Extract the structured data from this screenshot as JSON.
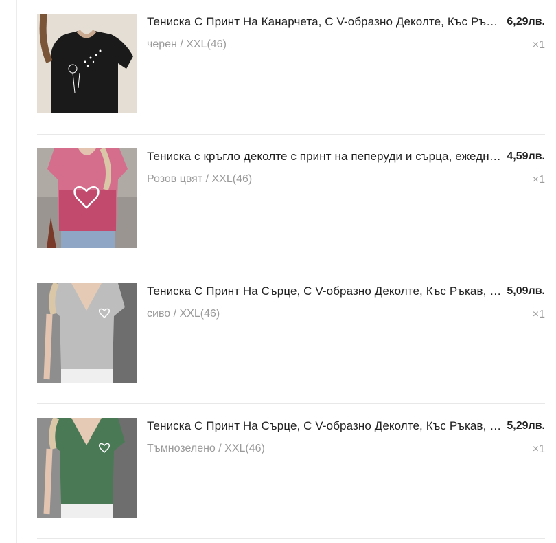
{
  "cart": {
    "items": [
      {
        "title": "Тениска С Принт На Канарчета, С V-образно Деколте, Къс Ръкав, Ежедневна",
        "variant": "черен / XXL(46)",
        "price": "6,29лв.",
        "quantity": "×1",
        "image": "black-tshirt-dandelion-print",
        "shirt_color": "#1a1a1a"
      },
      {
        "title": "Тениска с кръгло деколте с принт на пеперуди и сърца, ежедневна",
        "variant": "Розов цвят / XXL(46)",
        "price": "4,59лв.",
        "quantity": "×1",
        "image": "pink-tshirt-heart-print",
        "shirt_color": "#c85a7c"
      },
      {
        "title": "Тениска С Принт На Сърце, С V-образно Деколте, Къс Ръкав, Ежедневна",
        "variant": "сиво / XXL(46)",
        "price": "5,09лв.",
        "quantity": "×1",
        "image": "grey-tshirt-heart-print",
        "shirt_color": "#b8b8b8"
      },
      {
        "title": "Тениска С Принт На Сърце, С V-образно Деколте, Къс Ръкав, Ежедневна",
        "variant": "Тъмнозелено / XXL(46)",
        "price": "5,29лв.",
        "quantity": "×1",
        "image": "green-tshirt-heart-print",
        "shirt_color": "#4a7a55"
      }
    ]
  }
}
